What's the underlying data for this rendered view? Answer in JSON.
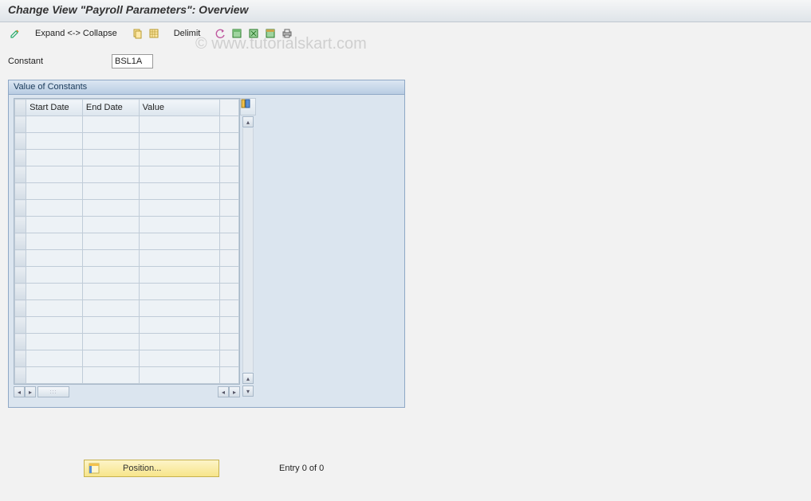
{
  "title": "Change View \"Payroll Parameters\": Overview",
  "toolbar": {
    "expand_collapse": "Expand <-> Collapse",
    "delimit": "Delimit"
  },
  "field": {
    "constant_label": "Constant",
    "constant_value": "BSL1A"
  },
  "panel": {
    "header": "Value of Constants",
    "columns": {
      "start_date": "Start Date",
      "end_date": "End Date",
      "value": "Value"
    }
  },
  "footer": {
    "position_label": "Position...",
    "entry_text": "Entry 0 of 0"
  },
  "watermark": "© www.tutorialskart.com"
}
